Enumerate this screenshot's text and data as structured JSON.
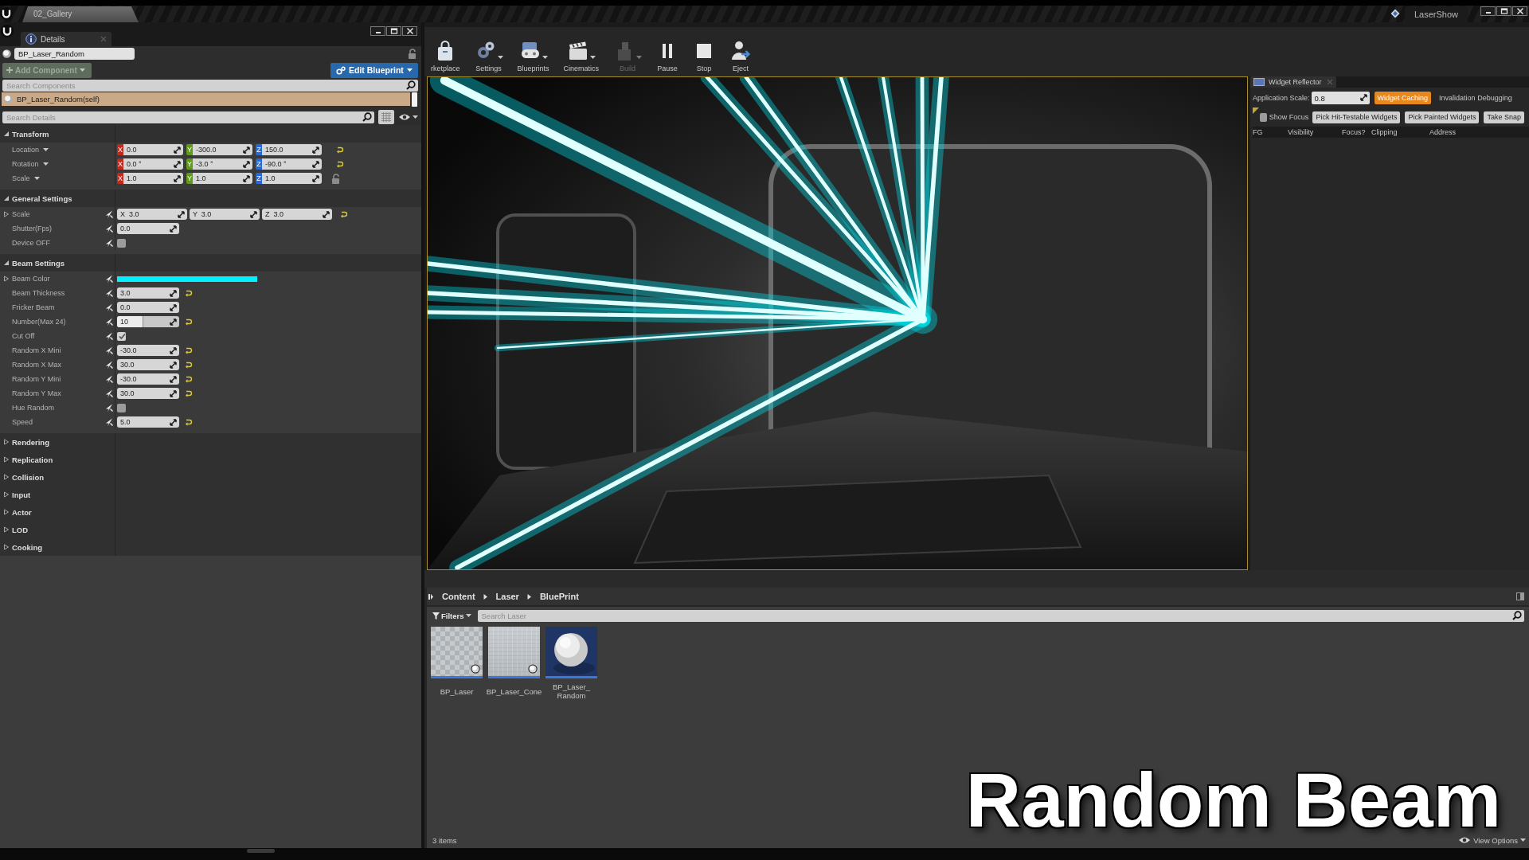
{
  "title_bar": {
    "tabs": [
      {
        "label": "02_Gallery",
        "selected": true
      }
    ],
    "project": "LaserShow"
  },
  "details": {
    "tab": "Details",
    "actor_name": "BP_Laser_Random",
    "add_component": {
      "label": "Add Component",
      "disabled": true
    },
    "edit_blueprint": {
      "label": "Edit Blueprint"
    },
    "search_components": {
      "placeholder": "Search Components"
    },
    "components": [
      {
        "label": "BP_Laser_Random(self)",
        "selected": true
      }
    ],
    "search_details": {
      "placeholder": "Search Details"
    },
    "sections": [
      {
        "title": "Transform",
        "expanded": true,
        "rows": [
          {
            "kind": "axes",
            "label": "Location",
            "reset": true,
            "fields": [
              {
                "axis": "X",
                "value": "0.0",
                "color": "#c4281c"
              },
              {
                "axis": "Y",
                "value": "-300.0",
                "color": "#5f9a1c"
              },
              {
                "axis": "Z",
                "value": "150.0",
                "color": "#2968d8"
              }
            ]
          },
          {
            "kind": "axes",
            "label": "Rotation",
            "reset": true,
            "fields": [
              {
                "axis": "X",
                "value": "0.0 °",
                "color": "#c4281c"
              },
              {
                "axis": "Y",
                "value": "-3.0 °",
                "color": "#5f9a1c"
              },
              {
                "axis": "Z",
                "value": "-90.0 °",
                "color": "#2968d8"
              }
            ]
          },
          {
            "kind": "axes",
            "label": "Scale",
            "reset": false,
            "locked": true,
            "fields": [
              {
                "axis": "X",
                "value": "1.0",
                "color": "#c4281c"
              },
              {
                "axis": "Y",
                "value": "1.0",
                "color": "#5f9a1c"
              },
              {
                "axis": "Z",
                "value": "1.0",
                "color": "#2968d8"
              }
            ]
          }
        ]
      },
      {
        "title": "General Settings",
        "expanded": true,
        "rows": [
          {
            "kind": "vector",
            "label": "Scale",
            "expanded": false,
            "reset": true,
            "fields": [
              {
                "axis": "X",
                "value": "3.0"
              },
              {
                "axis": "Y",
                "value": "3.0"
              },
              {
                "axis": "Z",
                "value": "3.0"
              }
            ]
          },
          {
            "kind": "number",
            "label": "Shutter(Fps)",
            "value": "0.0",
            "reset": false
          },
          {
            "kind": "checkbox",
            "label": "Device OFF",
            "checked": false,
            "reset": false
          }
        ]
      },
      {
        "title": "Beam Settings",
        "expanded": true,
        "rows": [
          {
            "kind": "color",
            "label": "Beam Color",
            "expanded": false,
            "color": "#00f0ff",
            "reset": false
          },
          {
            "kind": "number",
            "label": "Beam Thickness",
            "value": "3.0",
            "reset": true
          },
          {
            "kind": "number",
            "label": "Fricker Beam",
            "value": "0.0",
            "reset": false
          },
          {
            "kind": "slider",
            "label": "Number(Max 24)",
            "value": "10",
            "level": 0.42,
            "reset": true
          },
          {
            "kind": "checkbox",
            "label": "Cut Off",
            "checked": true,
            "reset": false
          },
          {
            "kind": "number",
            "label": "Random X Mini",
            "value": "-30.0",
            "reset": true
          },
          {
            "kind": "number",
            "label": "Random X Max",
            "value": "30.0",
            "reset": true
          },
          {
            "kind": "number",
            "label": "Random Y Mini",
            "value": "-30.0",
            "reset": true
          },
          {
            "kind": "number",
            "label": "Random Y Max",
            "value": "30.0",
            "reset": true
          },
          {
            "kind": "checkbox",
            "label": "Hue Random",
            "checked": false,
            "reset": false
          },
          {
            "kind": "number",
            "label": "Speed",
            "value": "5.0",
            "reset": true
          }
        ]
      },
      {
        "title": "Rendering",
        "expanded": false
      },
      {
        "title": "Replication",
        "expanded": false
      },
      {
        "title": "Collision",
        "expanded": false
      },
      {
        "title": "Input",
        "expanded": false
      },
      {
        "title": "Actor",
        "expanded": false
      },
      {
        "title": "LOD",
        "expanded": false
      },
      {
        "title": "Cooking",
        "expanded": false
      }
    ]
  },
  "toolbar": [
    {
      "kind": "marketplace",
      "label": "rketplace",
      "dropdown": false,
      "disabled": false
    },
    {
      "kind": "settings",
      "label": "Settings",
      "dropdown": true,
      "disabled": false
    },
    {
      "kind": "blueprints",
      "label": "Blueprints",
      "dropdown": true,
      "disabled": false
    },
    {
      "kind": "cinematics",
      "label": "Cinematics",
      "dropdown": true,
      "disabled": false
    },
    {
      "kind": "build",
      "label": "Build",
      "dropdown": true,
      "disabled": true
    },
    {
      "kind": "pause",
      "label": "Pause",
      "dropdown": false,
      "disabled": false
    },
    {
      "kind": "stop",
      "label": "Stop",
      "dropdown": false,
      "disabled": false
    },
    {
      "kind": "eject",
      "label": "Eject",
      "dropdown": false,
      "disabled": false
    }
  ],
  "widget_reflector": {
    "tab": "Widget Reflector",
    "scale_label": "Application Scale:",
    "scale_value": "0.8",
    "toggles": [
      {
        "label": "Widget Caching",
        "selected": true
      },
      {
        "label": "Invalidation Debugging",
        "selected": false
      }
    ],
    "show_focus": {
      "label": "Show Focus",
      "checked": false
    },
    "buttons": [
      "Pick Hit-Testable Widgets",
      "Pick Painted Widgets",
      "Take Snap"
    ],
    "columns": [
      "FG",
      "Visibility",
      "Focus?",
      "Clipping",
      "Address"
    ]
  },
  "content_browser": {
    "path": [
      "Content",
      "Laser",
      "BluePrint"
    ],
    "filters": "Filters",
    "search": {
      "placeholder": "Search Laser"
    },
    "assets": [
      {
        "label": "BP_Laser",
        "kind": "checker"
      },
      {
        "label": "BP_Laser_Cone",
        "kind": "grid"
      },
      {
        "label": "BP_Laser_Random",
        "kind": "sphere"
      }
    ],
    "item_count": "3 items",
    "view_options": "View Options"
  },
  "caption": "Random Beam"
}
